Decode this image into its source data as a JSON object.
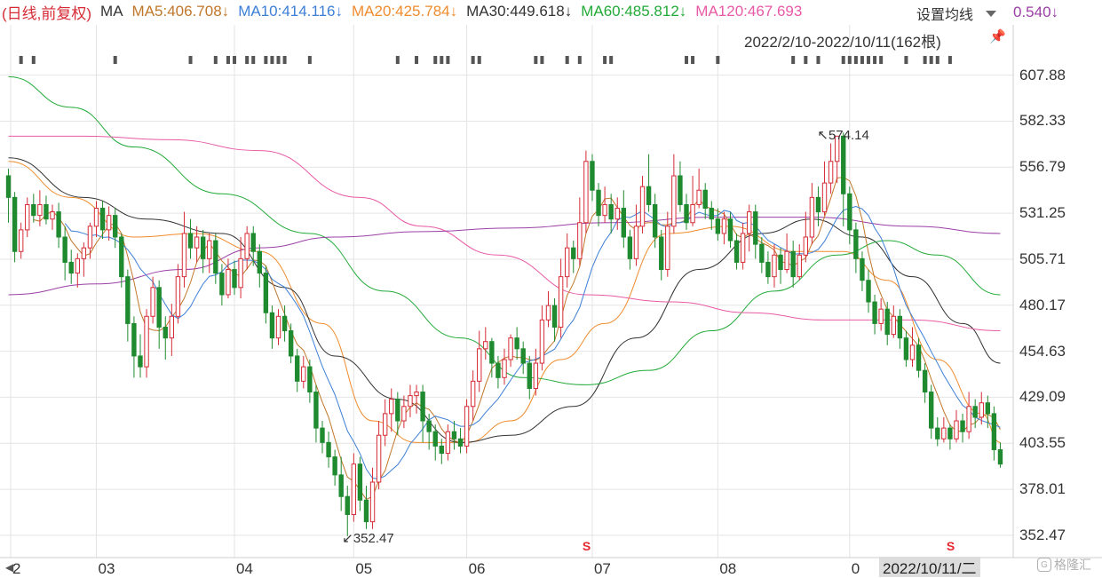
{
  "header": {
    "prefix": "(日线,前复权)",
    "ma_label": "MA",
    "ma_items": [
      {
        "text": "MA5:406.708↓",
        "color": "#c0772a"
      },
      {
        "text": "MA10:414.116↓",
        "color": "#3d7fd6"
      },
      {
        "text": "MA20:425.784↓",
        "color": "#ef8c2d"
      },
      {
        "text": "MA30:449.618↓",
        "color": "#333333"
      },
      {
        "text": "MA60:485.812↓",
        "color": "#22aa38"
      },
      {
        "text": "MA120:467.693",
        "color": "#e85aa6"
      }
    ],
    "ma120_tail": "0.540↓",
    "settings_label": "设置均线",
    "range": "2022/2/10-2022/10/11(162根)",
    "pin_icon": "pin-icon"
  },
  "colors": {
    "up": "#d62b36",
    "down": "#1f8a2f",
    "grid": "#e4e4e4"
  },
  "cursor_date": "2022/10/11/二",
  "watermark": "格隆汇",
  "annotations": {
    "high": "574.14",
    "low": "352.47"
  },
  "chart_data": {
    "type": "candlestick",
    "title": "",
    "xlabel": "",
    "ylabel": "",
    "ylim": [
      348,
      620
    ],
    "yticks": [
      "607.88",
      "582.33",
      "556.79",
      "531.25",
      "505.71",
      "480.17",
      "454.63",
      "429.09",
      "403.55",
      "378.01",
      "352.47"
    ],
    "x_months": [
      {
        "label": "2",
        "index": 0
      },
      {
        "label": "03",
        "index": 14
      },
      {
        "label": "04",
        "index": 36
      },
      {
        "label": "05",
        "index": 55
      },
      {
        "label": "06",
        "index": 73
      },
      {
        "label": "07",
        "index": 93
      },
      {
        "label": "08",
        "index": 113
      },
      {
        "label": "0",
        "index": 134
      }
    ],
    "grid": true,
    "high_point": {
      "index": 128,
      "value": 574.14
    },
    "low_point": {
      "index": 54,
      "value": 352.47
    },
    "s_marks": [
      92,
      150
    ],
    "candles": [
      [
        552,
        540,
        556,
        526
      ],
      [
        540,
        510,
        543,
        504
      ],
      [
        510,
        522,
        526,
        506
      ],
      [
        522,
        536,
        540,
        518
      ],
      [
        536,
        530,
        542,
        526
      ],
      [
        530,
        536,
        544,
        524
      ],
      [
        536,
        528,
        541,
        525
      ],
      [
        528,
        532,
        536,
        522
      ],
      [
        532,
        518,
        537,
        512
      ],
      [
        518,
        504,
        524,
        494
      ],
      [
        504,
        498,
        511,
        492
      ],
      [
        498,
        506,
        509,
        490
      ],
      [
        506,
        512,
        515,
        496
      ],
      [
        512,
        524,
        526,
        506
      ],
      [
        524,
        534,
        538,
        518
      ],
      [
        534,
        522,
        538,
        517
      ],
      [
        522,
        530,
        535,
        516
      ],
      [
        530,
        518,
        534,
        512
      ],
      [
        518,
        496,
        520,
        490
      ],
      [
        496,
        470,
        500,
        460
      ],
      [
        470,
        452,
        474,
        440
      ],
      [
        452,
        446,
        464,
        440
      ],
      [
        446,
        474,
        478,
        440
      ],
      [
        474,
        490,
        496,
        470
      ],
      [
        490,
        468,
        494,
        456
      ],
      [
        468,
        462,
        474,
        450
      ],
      [
        462,
        474,
        481,
        452
      ],
      [
        474,
        496,
        503,
        470
      ],
      [
        496,
        520,
        532,
        490
      ],
      [
        520,
        512,
        528,
        506
      ],
      [
        512,
        518,
        524,
        504
      ],
      [
        518,
        506,
        522,
        498
      ],
      [
        506,
        516,
        520,
        498
      ],
      [
        516,
        498,
        520,
        492
      ],
      [
        498,
        486,
        503,
        480
      ],
      [
        486,
        500,
        506,
        484
      ],
      [
        500,
        490,
        505,
        486
      ],
      [
        490,
        506,
        518,
        484
      ],
      [
        506,
        520,
        524,
        500
      ],
      [
        520,
        510,
        524,
        502
      ],
      [
        510,
        498,
        514,
        490
      ],
      [
        498,
        476,
        502,
        470
      ],
      [
        476,
        462,
        480,
        456
      ],
      [
        462,
        474,
        478,
        458
      ],
      [
        474,
        466,
        480,
        460
      ],
      [
        466,
        452,
        470,
        448
      ],
      [
        452,
        438,
        456,
        432
      ],
      [
        438,
        446,
        452,
        434
      ],
      [
        446,
        432,
        450,
        426
      ],
      [
        432,
        412,
        436,
        404
      ],
      [
        412,
        404,
        416,
        398
      ],
      [
        404,
        396,
        410,
        390
      ],
      [
        396,
        386,
        400,
        380
      ],
      [
        386,
        374,
        396,
        366
      ],
      [
        374,
        364,
        380,
        352
      ],
      [
        364,
        392,
        398,
        360
      ],
      [
        392,
        372,
        396,
        366
      ],
      [
        372,
        360,
        380,
        356
      ],
      [
        360,
        382,
        390,
        356
      ],
      [
        382,
        408,
        416,
        378
      ],
      [
        408,
        420,
        428,
        402
      ],
      [
        420,
        428,
        434,
        410
      ],
      [
        428,
        416,
        432,
        408
      ],
      [
        416,
        424,
        430,
        412
      ],
      [
        424,
        430,
        436,
        418
      ],
      [
        430,
        432,
        436,
        420
      ],
      [
        432,
        416,
        436,
        404
      ],
      [
        416,
        410,
        420,
        400
      ],
      [
        410,
        402,
        414,
        394
      ],
      [
        402,
        398,
        406,
        392
      ],
      [
        398,
        410,
        414,
        394
      ],
      [
        410,
        406,
        416,
        400
      ],
      [
        406,
        402,
        412,
        398
      ],
      [
        402,
        424,
        428,
        398
      ],
      [
        424,
        438,
        444,
        416
      ],
      [
        438,
        456,
        466,
        432
      ],
      [
        456,
        460,
        468,
        450
      ],
      [
        460,
        448,
        462,
        440
      ],
      [
        448,
        440,
        452,
        434
      ],
      [
        440,
        450,
        456,
        436
      ],
      [
        450,
        462,
        464,
        446
      ],
      [
        462,
        456,
        468,
        450
      ],
      [
        456,
        448,
        460,
        442
      ],
      [
        448,
        434,
        452,
        428
      ],
      [
        434,
        448,
        456,
        430
      ],
      [
        448,
        472,
        480,
        444
      ],
      [
        472,
        480,
        488,
        468
      ],
      [
        480,
        468,
        484,
        460
      ],
      [
        468,
        496,
        506,
        462
      ],
      [
        496,
        512,
        520,
        490
      ],
      [
        512,
        506,
        516,
        498
      ],
      [
        506,
        526,
        540,
        502
      ],
      [
        526,
        560,
        566,
        520
      ],
      [
        560,
        544,
        564,
        538
      ],
      [
        544,
        530,
        548,
        524
      ],
      [
        530,
        536,
        546,
        526
      ],
      [
        536,
        528,
        542,
        520
      ],
      [
        528,
        534,
        540,
        522
      ],
      [
        534,
        518,
        544,
        512
      ],
      [
        518,
        506,
        522,
        500
      ],
      [
        506,
        524,
        536,
        502
      ],
      [
        524,
        546,
        552,
        520
      ],
      [
        546,
        536,
        564,
        532
      ],
      [
        536,
        518,
        542,
        512
      ],
      [
        518,
        500,
        522,
        494
      ],
      [
        500,
        524,
        532,
        496
      ],
      [
        524,
        552,
        564,
        520
      ],
      [
        552,
        536,
        560,
        532
      ],
      [
        536,
        526,
        542,
        522
      ],
      [
        526,
        536,
        552,
        524
      ],
      [
        536,
        544,
        556,
        534
      ],
      [
        544,
        534,
        548,
        528
      ],
      [
        534,
        528,
        538,
        522
      ],
      [
        528,
        520,
        534,
        516
      ],
      [
        520,
        528,
        532,
        514
      ],
      [
        528,
        516,
        532,
        512
      ],
      [
        516,
        504,
        520,
        500
      ],
      [
        504,
        520,
        526,
        500
      ],
      [
        520,
        532,
        536,
        510
      ],
      [
        532,
        514,
        536,
        506
      ],
      [
        514,
        504,
        518,
        498
      ],
      [
        504,
        496,
        510,
        492
      ],
      [
        496,
        508,
        514,
        490
      ],
      [
        508,
        500,
        512,
        492
      ],
      [
        500,
        510,
        520,
        498
      ],
      [
        510,
        496,
        516,
        490
      ],
      [
        496,
        508,
        514,
        494
      ],
      [
        508,
        518,
        532,
        504
      ],
      [
        518,
        540,
        548,
        514
      ],
      [
        540,
        532,
        546,
        524
      ],
      [
        532,
        548,
        560,
        530
      ],
      [
        548,
        560,
        570,
        542
      ],
      [
        560,
        574,
        574,
        548
      ],
      [
        574,
        542,
        576,
        524
      ],
      [
        542,
        522,
        546,
        514
      ],
      [
        522,
        506,
        526,
        498
      ],
      [
        506,
        494,
        510,
        488
      ],
      [
        494,
        482,
        500,
        476
      ],
      [
        482,
        470,
        486,
        464
      ],
      [
        470,
        478,
        484,
        466
      ],
      [
        478,
        464,
        482,
        458
      ],
      [
        464,
        474,
        480,
        462
      ],
      [
        474,
        462,
        478,
        456
      ],
      [
        462,
        450,
        466,
        446
      ],
      [
        450,
        458,
        468,
        446
      ],
      [
        458,
        444,
        462,
        440
      ],
      [
        444,
        432,
        448,
        426
      ],
      [
        432,
        412,
        436,
        406
      ],
      [
        412,
        406,
        418,
        402
      ],
      [
        406,
        412,
        418,
        404
      ],
      [
        412,
        406,
        414,
        400
      ],
      [
        406,
        416,
        422,
        404
      ],
      [
        416,
        410,
        420,
        404
      ],
      [
        410,
        424,
        432,
        406
      ],
      [
        424,
        418,
        428,
        412
      ],
      [
        418,
        426,
        432,
        414
      ],
      [
        426,
        420,
        430,
        412
      ],
      [
        420,
        400,
        424,
        394
      ],
      [
        400,
        392,
        404,
        390
      ]
    ],
    "series": [
      {
        "name": "MA5",
        "color": "#c0772a"
      },
      {
        "name": "MA10",
        "color": "#3d7fd6"
      },
      {
        "name": "MA20",
        "color": "#ef8c2d"
      },
      {
        "name": "MA30",
        "color": "#333333"
      },
      {
        "name": "MA60",
        "color": "#22aa38"
      },
      {
        "name": "MA120",
        "color": "#e85aa6"
      },
      {
        "name": "MA250",
        "color": "#9b3fa6"
      }
    ],
    "ma_curves": {
      "MA20": [
        [
          0,
          560
        ],
        [
          10,
          540
        ],
        [
          20,
          518
        ],
        [
          30,
          520
        ],
        [
          40,
          510
        ],
        [
          50,
          470
        ],
        [
          58,
          416
        ],
        [
          65,
          404
        ],
        [
          73,
          404
        ],
        [
          80,
          416
        ],
        [
          88,
          450
        ],
        [
          95,
          470
        ],
        [
          105,
          520
        ],
        [
          115,
          524
        ],
        [
          125,
          510
        ],
        [
          133,
          510
        ],
        [
          140,
          494
        ],
        [
          148,
          450
        ],
        [
          155,
          420
        ],
        [
          158,
          404
        ]
      ],
      "MA30": [
        [
          0,
          562
        ],
        [
          12,
          540
        ],
        [
          22,
          528
        ],
        [
          34,
          520
        ],
        [
          44,
          490
        ],
        [
          52,
          452
        ],
        [
          62,
          428
        ],
        [
          72,
          404
        ],
        [
          80,
          408
        ],
        [
          90,
          424
        ],
        [
          100,
          462
        ],
        [
          110,
          500
        ],
        [
          120,
          520
        ],
        [
          128,
          528
        ],
        [
          136,
          518
        ],
        [
          144,
          496
        ],
        [
          152,
          470
        ],
        [
          158,
          448
        ]
      ],
      "MA60": [
        [
          0,
          607
        ],
        [
          10,
          590
        ],
        [
          20,
          568
        ],
        [
          34,
          542
        ],
        [
          48,
          520
        ],
        [
          60,
          488
        ],
        [
          72,
          462
        ],
        [
          82,
          440
        ],
        [
          92,
          436
        ],
        [
          102,
          444
        ],
        [
          112,
          466
        ],
        [
          122,
          488
        ],
        [
          132,
          508
        ],
        [
          140,
          516
        ],
        [
          148,
          508
        ],
        [
          158,
          486
        ]
      ],
      "MA120": [
        [
          0,
          574
        ],
        [
          12,
          574
        ],
        [
          26,
          572
        ],
        [
          40,
          566
        ],
        [
          56,
          540
        ],
        [
          66,
          524
        ],
        [
          78,
          508
        ],
        [
          92,
          486
        ],
        [
          106,
          482
        ],
        [
          118,
          476
        ],
        [
          130,
          472
        ],
        [
          144,
          472
        ],
        [
          158,
          466
        ]
      ],
      "MA250": [
        [
          0,
          486
        ],
        [
          14,
          492
        ],
        [
          28,
          500
        ],
        [
          40,
          512
        ],
        [
          52,
          518
        ],
        [
          66,
          521
        ],
        [
          80,
          523
        ],
        [
          96,
          526
        ],
        [
          112,
          529
        ],
        [
          128,
          529
        ],
        [
          144,
          524
        ],
        [
          158,
          520
        ]
      ]
    }
  }
}
